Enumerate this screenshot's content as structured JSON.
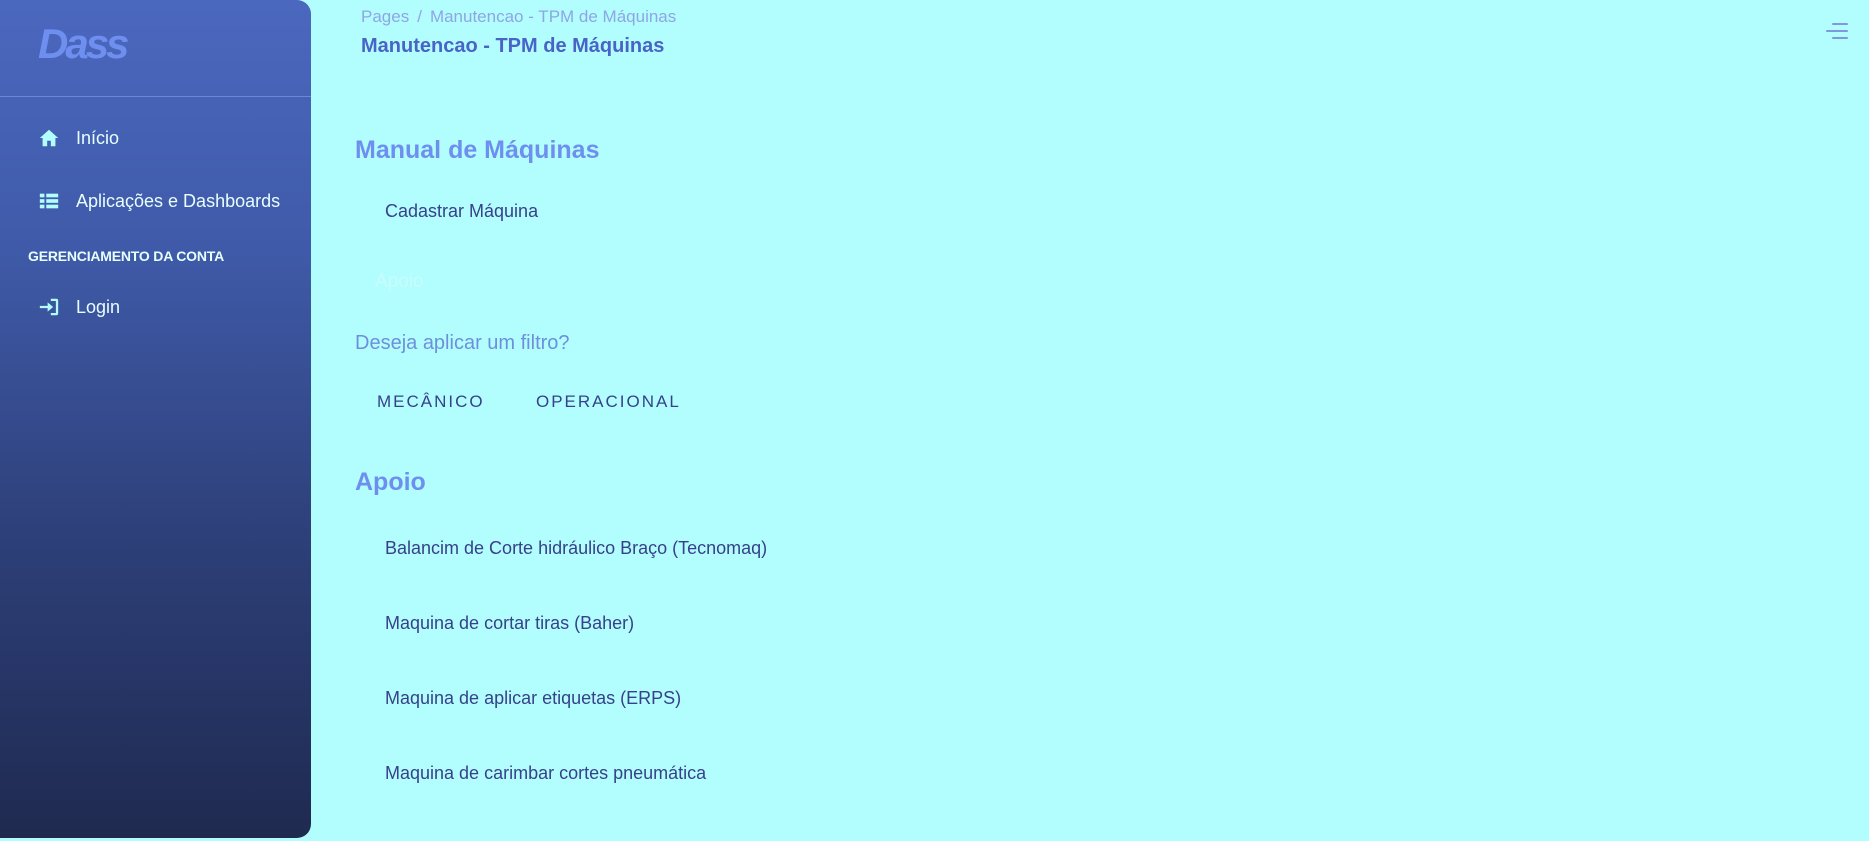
{
  "sidebar": {
    "brand": "Dass",
    "nav": [
      {
        "label": "Início",
        "icon": "home-icon"
      },
      {
        "label": "Aplicações e Dashboards",
        "icon": "grid-icon"
      }
    ],
    "account_section": "GERENCIAMENTO DA CONTA",
    "account_items": [
      {
        "label": "Login",
        "icon": "login-icon"
      }
    ]
  },
  "header": {
    "breadcrumb": [
      "Pages",
      "Manutencao - TPM de Máquinas"
    ],
    "breadcrumb_separator": "/",
    "title": "Manutencao - TPM de Máquinas"
  },
  "main": {
    "manual_heading": "Manual de Máquinas",
    "cadastrar_label": "Cadastrar Máquina",
    "faded_label": "Apoio",
    "filter_question": "Deseja aplicar um filtro?",
    "filters": [
      "MECÂNICO",
      "OPERACIONAL"
    ],
    "apoio_heading": "Apoio",
    "machines": [
      "Balancim de Corte hidráulico Braço (Tecnomaq)",
      "Maquina de cortar tiras (Baher)",
      "Maquina de aplicar etiquetas (ERPS)",
      "Maquina de carimbar cortes pneumática"
    ]
  },
  "colors": {
    "background": "#b2fefe",
    "sidebar_top": "#4b68bf",
    "sidebar_bottom": "#1f2a50",
    "accent": "#6e8ff0",
    "title": "#4a63c6",
    "link_text": "#37418a"
  }
}
